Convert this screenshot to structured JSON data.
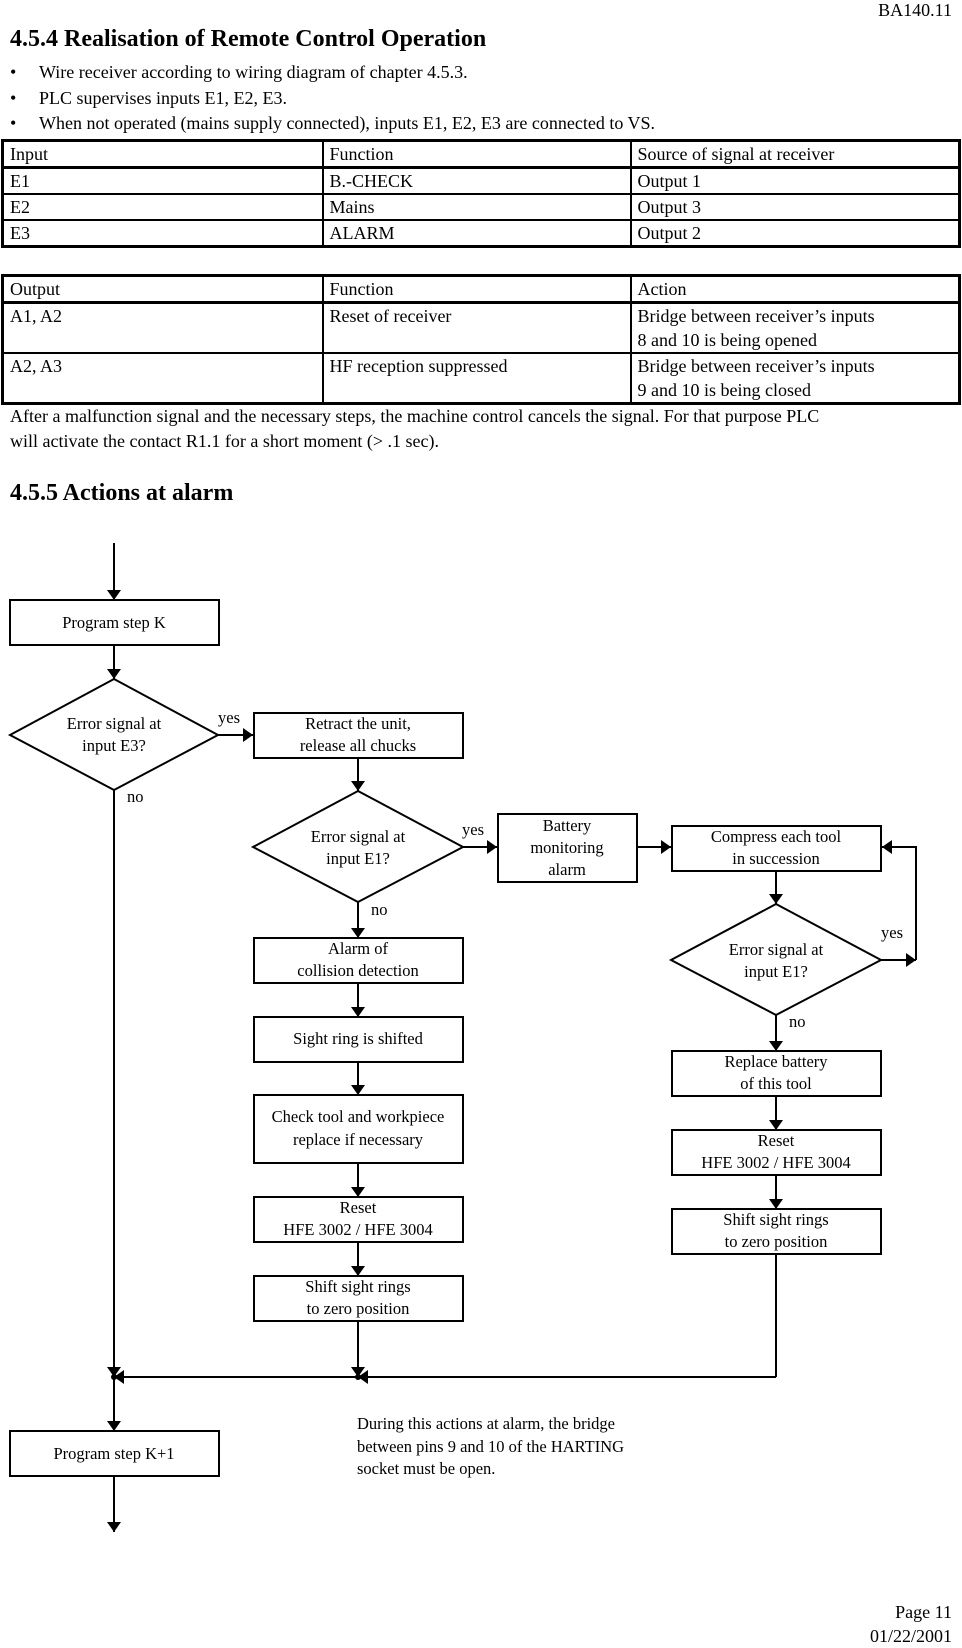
{
  "header": {
    "doc_id": "BA140.11"
  },
  "section_454": {
    "title": "4.5.4 Realisation of Remote Control Operation",
    "bullets": [
      "Wire receiver according to wiring diagram of chapter 4.5.3.",
      "PLC supervises inputs E1, E2, E3.",
      "When not operated (mains supply connected), inputs E1, E2, E3 are connected to VS."
    ],
    "inputs_table": {
      "headers": [
        "Input",
        "Function",
        "Source of signal at receiver"
      ],
      "rows": [
        [
          "E1",
          "B.-CHECK",
          "Output 1"
        ],
        [
          "E2",
          "Mains",
          "Output 3"
        ],
        [
          "E3",
          "ALARM",
          "Output 2"
        ]
      ]
    },
    "outputs_table": {
      "headers": [
        "Output",
        "Function",
        "Action"
      ],
      "rows": [
        [
          "A1, A2",
          "Reset of receiver",
          "Bridge between receiver’s inputs",
          "8 and 10 is being opened"
        ],
        [
          "A2, A3",
          "HF reception suppressed",
          "Bridge between receiver’s inputs",
          "9 and 10 is being closed"
        ]
      ]
    },
    "paragraph_line1": "After a malfunction signal and the necessary steps, the machine control cancels the signal. For that purpose PLC",
    "paragraph_line2": "will activate the contact R1.1 for a short moment (> .1 sec)."
  },
  "section_455": {
    "title": "4.5.5 Actions at alarm",
    "flowchart": {
      "program_step_k": "Program step K",
      "decision_e3": [
        "Error signal at",
        "input E3?"
      ],
      "retract": [
        "Retract the unit,",
        "release all chucks"
      ],
      "decision_e1_left": [
        "Error signal at",
        "input E1?"
      ],
      "battery_alarm": [
        "Battery",
        "monitoring",
        "alarm"
      ],
      "compress": [
        "Compress each tool",
        "in succession"
      ],
      "decision_e1_right": [
        "Error signal at",
        "input E1?"
      ],
      "alarm_collision": [
        "Alarm of",
        "collision detection"
      ],
      "sight_ring_shifted": "Sight ring is shifted",
      "check_tool": [
        "Check tool and workpiece",
        "replace if necessary"
      ],
      "reset_left": [
        "Reset",
        "HFE 3002 / HFE 3004"
      ],
      "shift_left": [
        "Shift sight rings",
        "to zero position"
      ],
      "replace_battery": [
        "Replace battery",
        "of this tool"
      ],
      "reset_right": [
        "Reset",
        "HFE 3002 / HFE 3004"
      ],
      "shift_right": [
        "Shift sight rings",
        "to zero position"
      ],
      "program_step_k1": "Program step K+1",
      "label_yes": "yes",
      "label_no": "no"
    },
    "note": [
      "During this actions at alarm, the bridge",
      "between pins 9 and 10 of the HARTING",
      "socket must be open."
    ]
  },
  "footer": {
    "page": "Page 11",
    "date": "01/22/2001"
  }
}
